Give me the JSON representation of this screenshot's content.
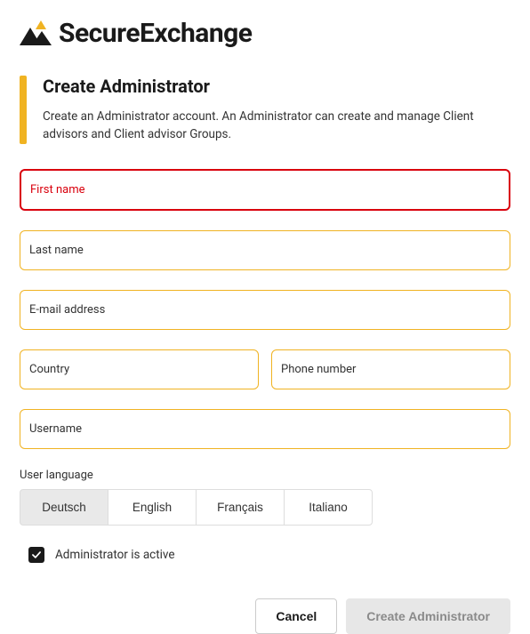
{
  "brand": "SecureExchange",
  "header": {
    "title": "Create Administrator",
    "description": "Create an Administrator account. An Administrator can create and manage Client advisors and Client advisor Groups."
  },
  "fields": {
    "first_name": {
      "label": "First name",
      "value": "",
      "error": true
    },
    "last_name": {
      "label": "Last name",
      "value": ""
    },
    "email": {
      "label": "E-mail address",
      "value": ""
    },
    "country": {
      "label": "Country",
      "value": ""
    },
    "phone": {
      "label": "Phone number",
      "value": ""
    },
    "username": {
      "label": "Username",
      "value": ""
    }
  },
  "language": {
    "label": "User language",
    "options": [
      "Deutsch",
      "English",
      "Français",
      "Italiano"
    ],
    "selected": "Deutsch"
  },
  "active_checkbox": {
    "label": "Administrator is active",
    "checked": true
  },
  "actions": {
    "cancel": "Cancel",
    "submit": "Create Administrator"
  }
}
